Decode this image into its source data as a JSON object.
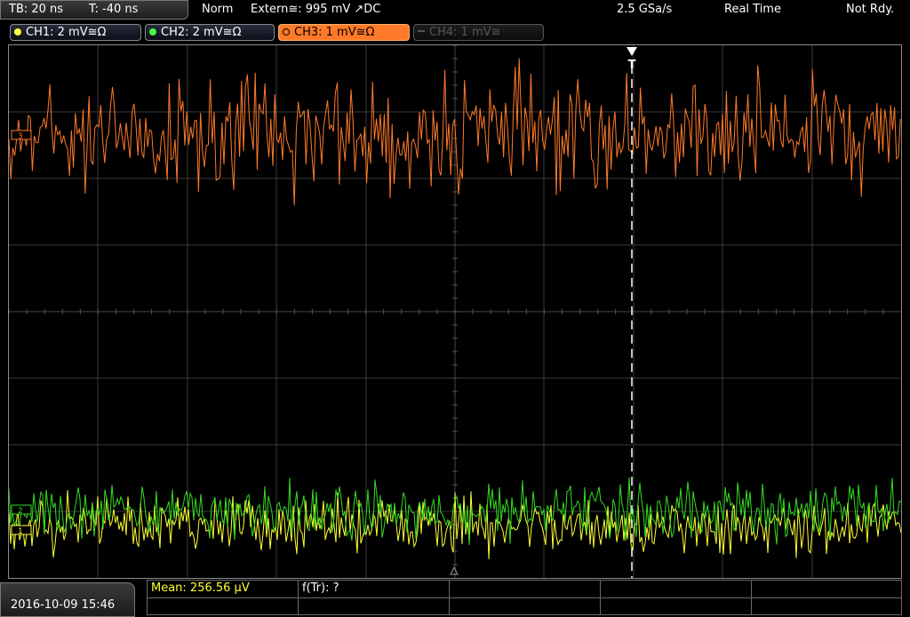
{
  "header": {
    "timebase": "TB: 20 ns",
    "trigger_time": "T: -40 ns",
    "mode": "Norm",
    "trigger_source": "Extern≅: 995 mV ↗DC",
    "sample_rate": "2.5 GSa/s",
    "acquisition": "Real Time",
    "status": "Not Rdy."
  },
  "channels": [
    {
      "label": "CH1: 2 mV≅Ω",
      "color": "#ffff40",
      "state": "on"
    },
    {
      "label": "CH2: 2 mV≅Ω",
      "color": "#40ff40",
      "state": "on"
    },
    {
      "label": "CH3: 1 mV≅Ω",
      "color": "#ff7a28",
      "state": "active"
    },
    {
      "label": "CH4: 1 mV≅",
      "color": "#555555",
      "state": "off"
    }
  ],
  "markers": {
    "trigger": "T",
    "ch3": "3",
    "ch2": "2",
    "ch1": "1"
  },
  "colors": {
    "ch1": "#ffff33",
    "ch2": "#33dd22",
    "ch3": "#ff7a28",
    "grid": "#3a3a3a"
  },
  "footer": {
    "datetime": "2016-10-09 15:46",
    "mean": "Mean: 256.56 µV",
    "ftr": "f(Tr): ?"
  }
}
